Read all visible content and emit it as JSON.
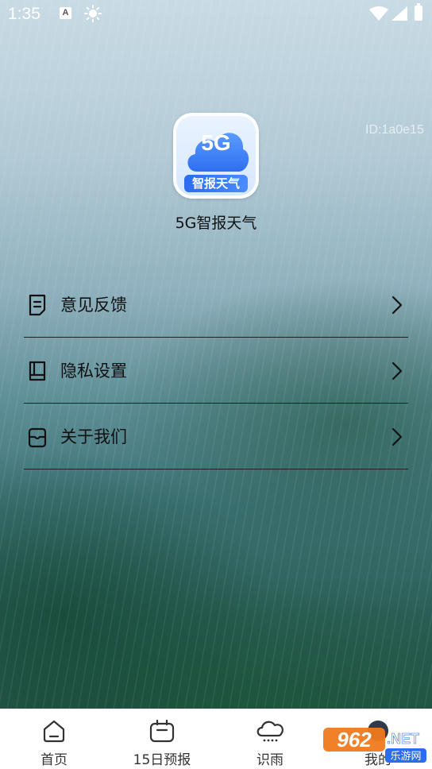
{
  "status_bar": {
    "time": "1:35",
    "notification_letter": "A"
  },
  "app": {
    "id_text": "ID:1a0e15",
    "name": "5G智报天气",
    "logo_5g": "5G",
    "logo_ribbon": "智报天气"
  },
  "menu": {
    "items": [
      {
        "label": "意见反馈",
        "icon": "feedback-document-icon"
      },
      {
        "label": "隐私设置",
        "icon": "privacy-book-icon"
      },
      {
        "label": "关于我们",
        "icon": "about-box-icon"
      }
    ]
  },
  "bottom_nav": {
    "items": [
      {
        "label": "首页",
        "icon": "home-icon"
      },
      {
        "label": "15日预报",
        "icon": "calendar-icon"
      },
      {
        "label": "识雨",
        "icon": "rain-cloud-icon"
      },
      {
        "label": "我的",
        "icon": "profile-icon"
      }
    ]
  },
  "watermark": {
    "main": "962",
    "suffix": ".NET",
    "sub": "乐游网"
  },
  "colors": {
    "accent_blue": "#2b6cf0",
    "divider": "#222222",
    "text_dark": "#111111"
  }
}
